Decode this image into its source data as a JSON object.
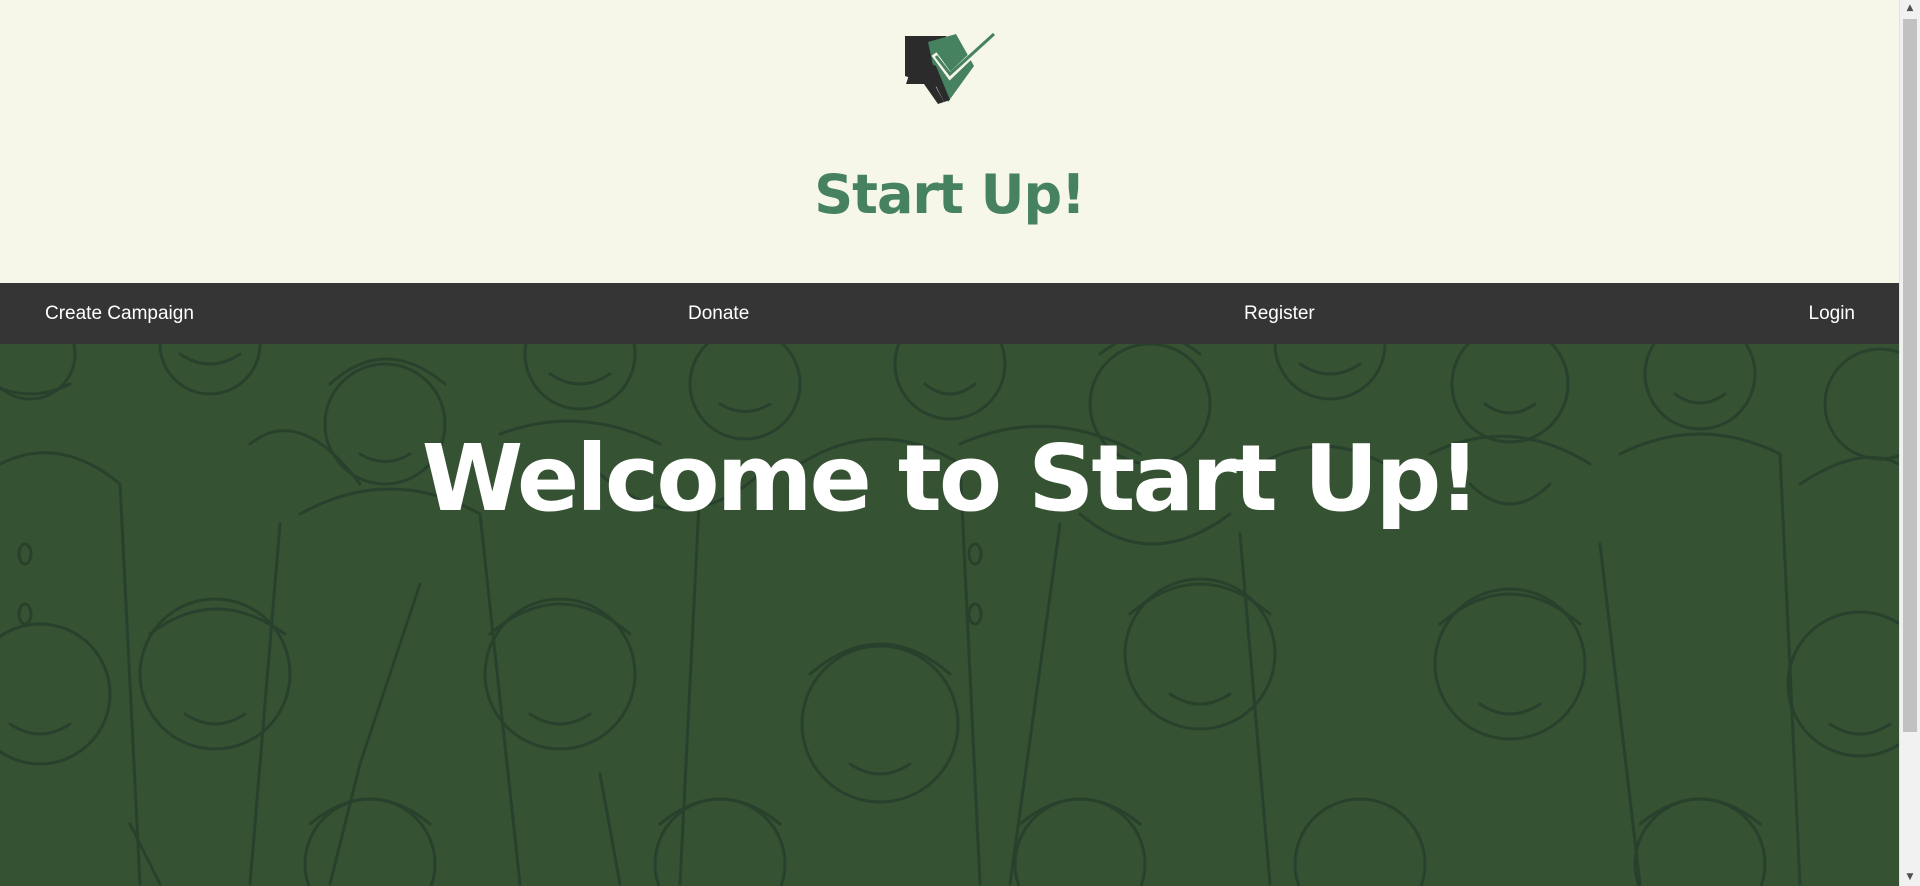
{
  "header": {
    "logo_icon": "checkmark-ballot-logo",
    "title": "Start Up!"
  },
  "nav": {
    "items": [
      {
        "label": "Create Campaign"
      },
      {
        "label": "Donate"
      },
      {
        "label": "Register"
      },
      {
        "label": "Login"
      }
    ]
  },
  "hero": {
    "title": "Welcome to Start Up!",
    "pattern": "crowd-of-people-line-art"
  },
  "colors": {
    "header_bg": "#f6f7e9",
    "brand_green": "#468160",
    "nav_bg": "#353535",
    "hero_bg": "#355232",
    "hero_lines": "#27402d",
    "text_light": "#ffffff"
  }
}
